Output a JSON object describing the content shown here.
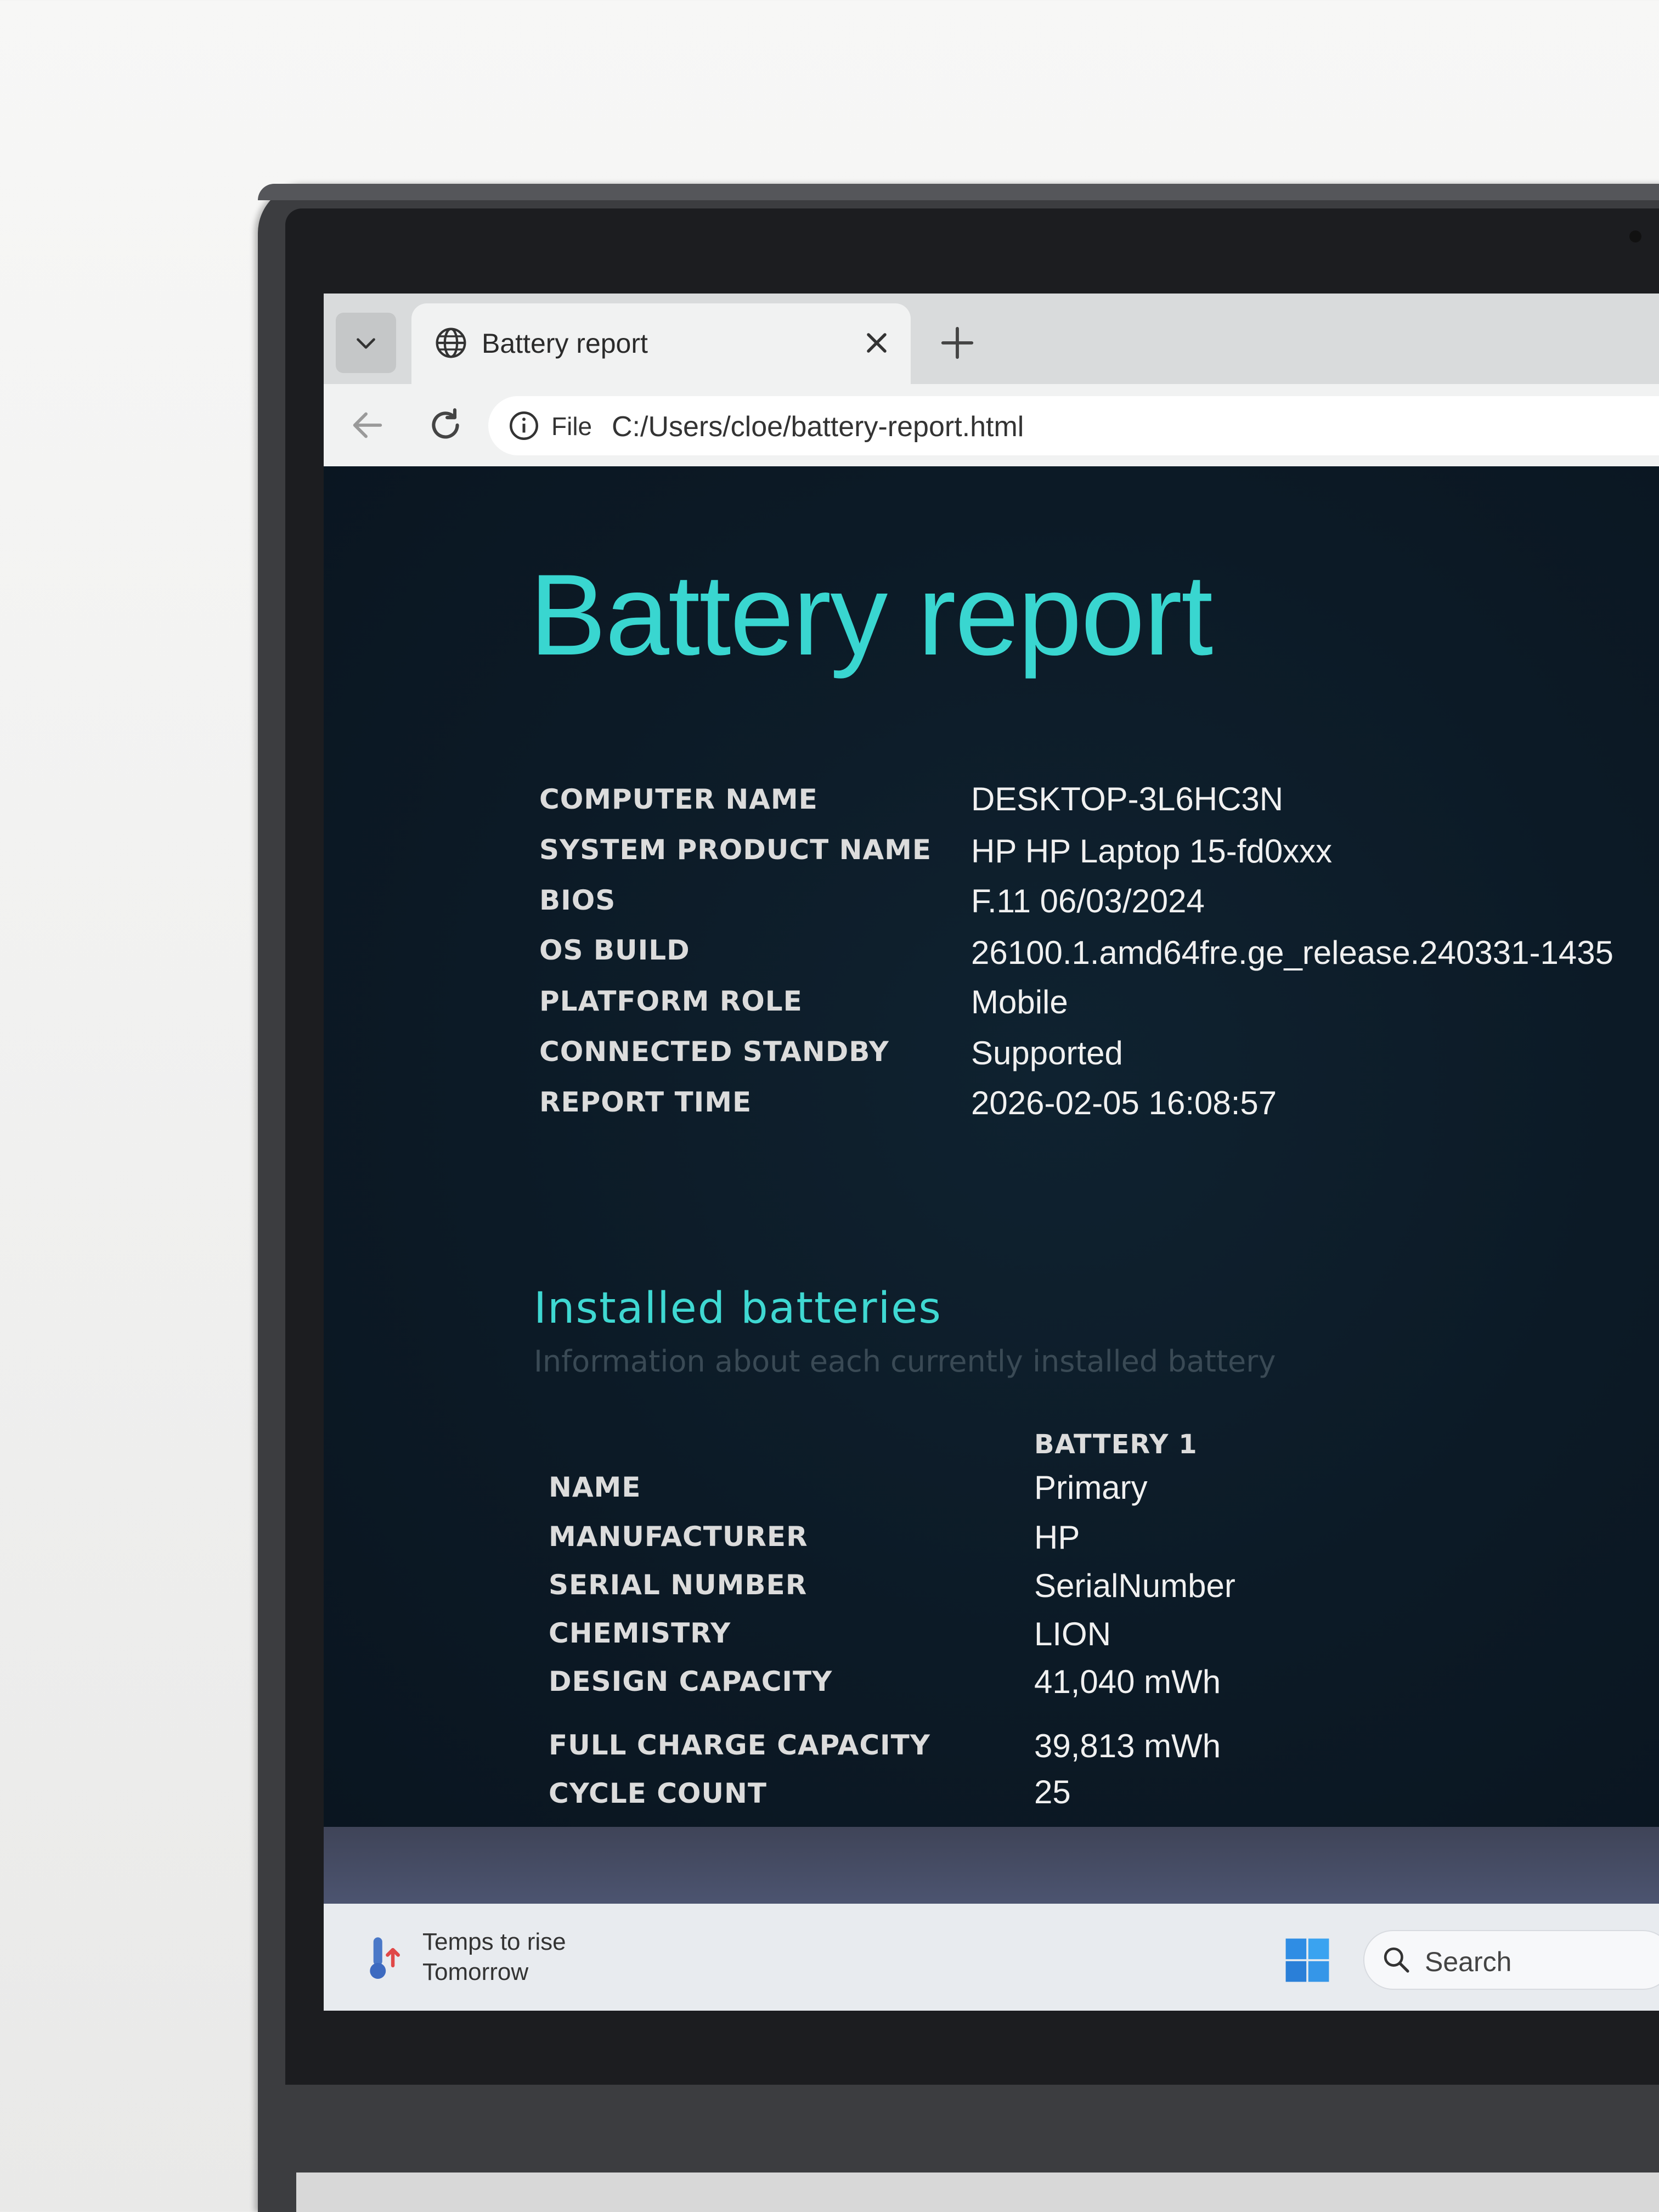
{
  "browser": {
    "tab_title": "Battery report",
    "address_scheme": "File",
    "address_url": "C:/Users/cloe/battery-report.html"
  },
  "report": {
    "title": "Battery report",
    "system_info": [
      {
        "label": "COMPUTER NAME",
        "value": "DESKTOP-3L6HC3N"
      },
      {
        "label": "SYSTEM PRODUCT NAME",
        "value": "HP HP Laptop 15-fd0xxx"
      },
      {
        "label": "BIOS",
        "value": "F.11 06/03/2024"
      },
      {
        "label": "OS BUILD",
        "value": "26100.1.amd64fre.ge_release.240331-1435"
      },
      {
        "label": "PLATFORM ROLE",
        "value": "Mobile"
      },
      {
        "label": "CONNECTED STANDBY",
        "value": "Supported"
      },
      {
        "label": "REPORT TIME",
        "value": "2026-02-05  16:08:57"
      }
    ],
    "installed_batteries": {
      "title": "Installed batteries",
      "subtitle": "Information about each currently installed battery",
      "column_header": "BATTERY 1",
      "rows": [
        {
          "label": "NAME",
          "value": "Primary"
        },
        {
          "label": "MANUFACTURER",
          "value": "HP"
        },
        {
          "label": "SERIAL NUMBER",
          "value": "SerialNumber"
        },
        {
          "label": "CHEMISTRY",
          "value": "LION"
        },
        {
          "label": "DESIGN CAPACITY",
          "value": "41,040 mWh"
        },
        {
          "label": "FULL CHARGE CAPACITY",
          "value": "39,813 mWh"
        },
        {
          "label": "CYCLE COUNT",
          "value": "25"
        }
      ]
    }
  },
  "taskbar": {
    "weather_line1": "Temps to rise",
    "weather_line2": "Tomorrow",
    "search_label": "Search"
  },
  "colors": {
    "heading": "#39d6d0",
    "page_background": "#0d1a26"
  }
}
